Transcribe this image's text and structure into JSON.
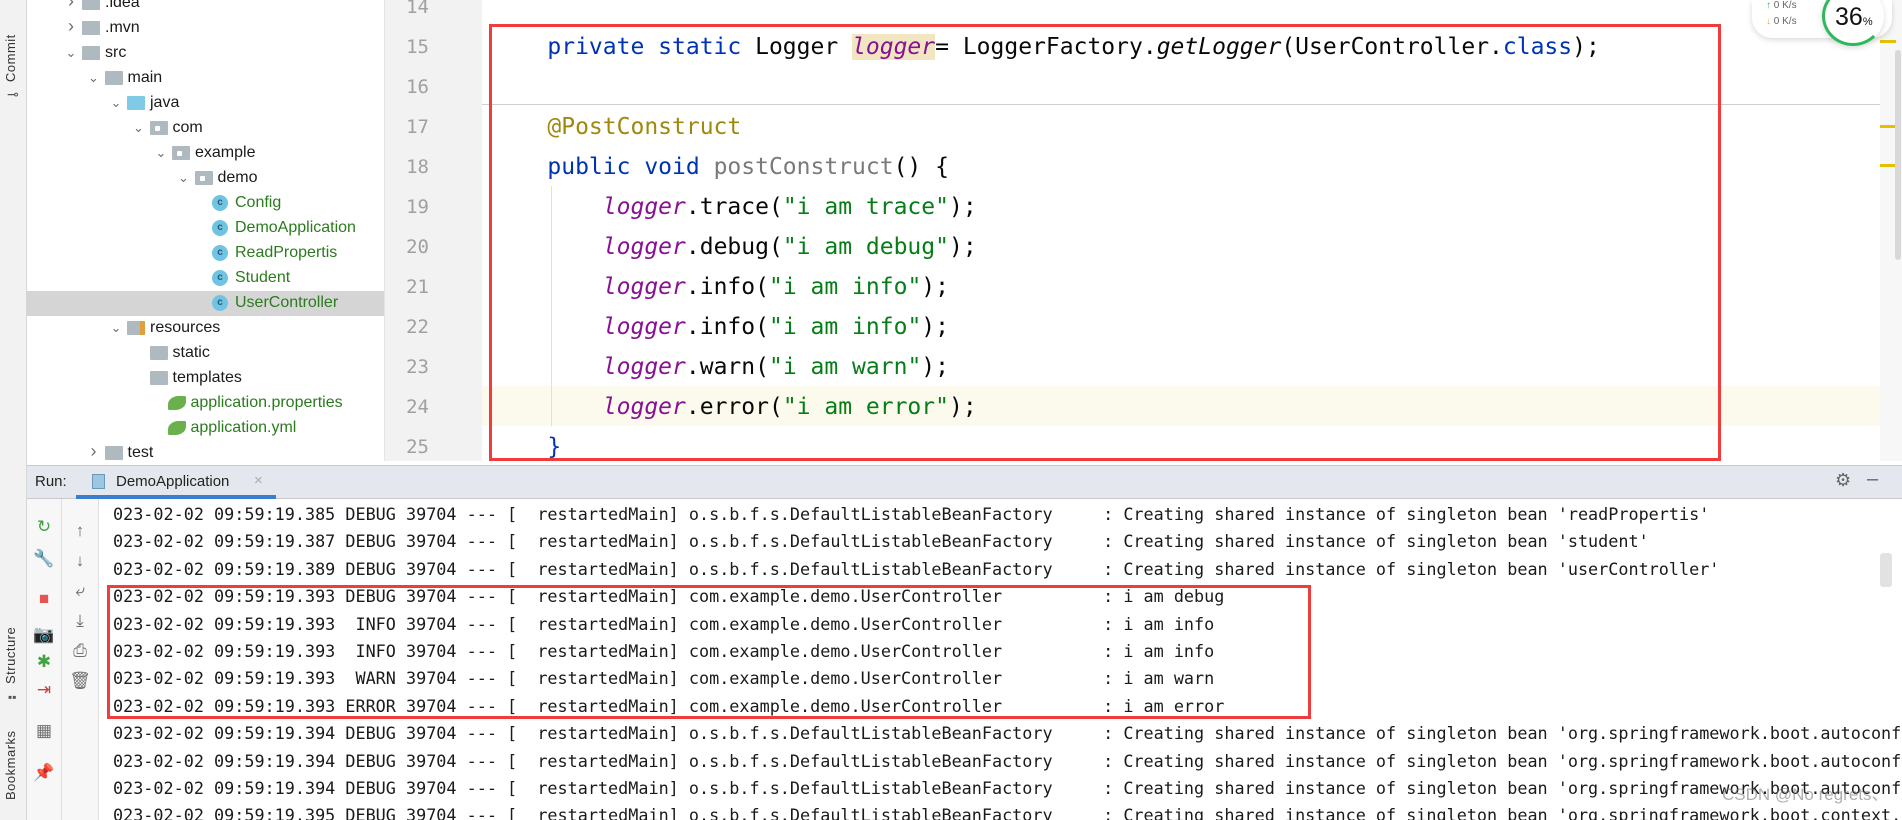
{
  "side_strip": {
    "commit": "Commit",
    "structure": "Structure",
    "bookmarks": "Bookmarks"
  },
  "project_tree": [
    {
      "label": ".idea",
      "level": 0,
      "icon": "folder",
      "chevron": "right"
    },
    {
      "label": ".mvn",
      "level": 0,
      "icon": "folder",
      "chevron": "right"
    },
    {
      "label": "src",
      "level": 0,
      "icon": "folder",
      "chevron": "down"
    },
    {
      "label": "main",
      "level": 1,
      "icon": "folder",
      "chevron": "down"
    },
    {
      "label": "java",
      "level": 2,
      "icon": "source-folder",
      "chevron": "down"
    },
    {
      "label": "com",
      "level": 3,
      "icon": "package",
      "chevron": "down"
    },
    {
      "label": "example",
      "level": 4,
      "icon": "package",
      "chevron": "down"
    },
    {
      "label": "demo",
      "level": 5,
      "icon": "package",
      "chevron": "down"
    },
    {
      "label": "Config",
      "level": 6,
      "icon": "class",
      "green": true
    },
    {
      "label": "DemoApplication",
      "level": 6,
      "icon": "class",
      "green": true
    },
    {
      "label": "ReadPropertis",
      "level": 6,
      "icon": "class",
      "green": true
    },
    {
      "label": "Student",
      "level": 6,
      "icon": "class",
      "green": true
    },
    {
      "label": "UserController",
      "level": 6,
      "icon": "class",
      "green": true,
      "selected": true
    },
    {
      "label": "resources",
      "level": 2,
      "icon": "resources-folder",
      "chevron": "down"
    },
    {
      "label": "static",
      "level": 3,
      "icon": "folder"
    },
    {
      "label": "templates",
      "level": 3,
      "icon": "folder"
    },
    {
      "label": "application.properties",
      "level": 3,
      "icon": "spring-leaf",
      "green": true
    },
    {
      "label": "application.yml",
      "level": 3,
      "icon": "spring-leaf",
      "green": true
    },
    {
      "label": "test",
      "level": 1,
      "icon": "folder",
      "chevron": "right"
    }
  ],
  "editor": {
    "line_numbers": [
      "14",
      "15",
      "16",
      "17",
      "18",
      "19",
      "20",
      "21",
      "22",
      "23",
      "24",
      "25"
    ],
    "lines": [
      [],
      [
        {
          "t": "    "
        },
        {
          "t": "private static ",
          "c": "kw"
        },
        {
          "t": "Logger "
        },
        {
          "t": "logger",
          "c": "fld hl"
        },
        {
          "t": "= LoggerFactory."
        },
        {
          "t": "getLogger",
          "c": "it"
        },
        {
          "t": "(UserController."
        },
        {
          "t": "class",
          "c": "kw"
        },
        {
          "t": ");"
        }
      ],
      [],
      [
        {
          "t": "    "
        },
        {
          "t": "@PostConstruct",
          "c": "ann"
        }
      ],
      [
        {
          "t": "    "
        },
        {
          "t": "public void ",
          "c": "kw"
        },
        {
          "t": "postConstruct",
          "c": "gray"
        },
        {
          "t": "() {"
        }
      ],
      [
        {
          "t": "        "
        },
        {
          "t": "logger",
          "c": "fld"
        },
        {
          "t": ".trace("
        },
        {
          "t": "\"i am trace\"",
          "c": "str"
        },
        {
          "t": ");"
        }
      ],
      [
        {
          "t": "        "
        },
        {
          "t": "logger",
          "c": "fld"
        },
        {
          "t": ".debug("
        },
        {
          "t": "\"i am debug\"",
          "c": "str"
        },
        {
          "t": ");"
        }
      ],
      [
        {
          "t": "        "
        },
        {
          "t": "logger",
          "c": "fld"
        },
        {
          "t": ".info("
        },
        {
          "t": "\"i am info\"",
          "c": "str"
        },
        {
          "t": ");"
        }
      ],
      [
        {
          "t": "        "
        },
        {
          "t": "logger",
          "c": "fld"
        },
        {
          "t": ".info("
        },
        {
          "t": "\"i am info\"",
          "c": "str"
        },
        {
          "t": ");"
        }
      ],
      [
        {
          "t": "        "
        },
        {
          "t": "logger",
          "c": "fld"
        },
        {
          "t": ".warn("
        },
        {
          "t": "\"i am warn\"",
          "c": "str"
        },
        {
          "t": ");"
        }
      ],
      [
        {
          "t": "        "
        },
        {
          "t": "logger",
          "c": "fld"
        },
        {
          "t": ".error("
        },
        {
          "t": "\"i am error\"",
          "c": "str"
        },
        {
          "t": ");"
        }
      ],
      [
        {
          "t": "    "
        },
        {
          "t": "}",
          "c": "kw"
        }
      ]
    ]
  },
  "network_widget": {
    "upload": "0",
    "download": "0",
    "unit": "K/s",
    "percent": "36",
    "percent_sign": "%"
  },
  "run_panel": {
    "label": "Run:",
    "tab": "DemoApplication",
    "close": "×"
  },
  "console_lines": [
    "023-02-02 09:59:19.385 DEBUG 39704 --- [  restartedMain] o.s.b.f.s.DefaultListableBeanFactory     : Creating shared instance of singleton bean 'readPropertis'",
    "023-02-02 09:59:19.387 DEBUG 39704 --- [  restartedMain] o.s.b.f.s.DefaultListableBeanFactory     : Creating shared instance of singleton bean 'student'",
    "023-02-02 09:59:19.389 DEBUG 39704 --- [  restartedMain] o.s.b.f.s.DefaultListableBeanFactory     : Creating shared instance of singleton bean 'userController'",
    "023-02-02 09:59:19.393 DEBUG 39704 --- [  restartedMain] com.example.demo.UserController          : i am debug",
    "023-02-02 09:59:19.393  INFO 39704 --- [  restartedMain] com.example.demo.UserController          : i am info",
    "023-02-02 09:59:19.393  INFO 39704 --- [  restartedMain] com.example.demo.UserController          : i am info",
    "023-02-02 09:59:19.393  WARN 39704 --- [  restartedMain] com.example.demo.UserController          : i am warn",
    "023-02-02 09:59:19.393 ERROR 39704 --- [  restartedMain] com.example.demo.UserController          : i am error",
    "023-02-02 09:59:19.394 DEBUG 39704 --- [  restartedMain] o.s.b.f.s.DefaultListableBeanFactory     : Creating shared instance of singleton bean 'org.springframework.boot.autoconfi",
    "023-02-02 09:59:19.394 DEBUG 39704 --- [  restartedMain] o.s.b.f.s.DefaultListableBeanFactory     : Creating shared instance of singleton bean 'org.springframework.boot.autoconfi",
    "023-02-02 09:59:19.394 DEBUG 39704 --- [  restartedMain] o.s.b.f.s.DefaultListableBeanFactory     : Creating shared instance of singleton bean 'org.springframework.boot.autoconfi",
    "023-02-02 09:59:19.395 DEBUG 39704 --- [  restartedMain] o.s.b.f.s.DefaultListableBeanFactory     : Creating shared instance of singleton bean 'org.springframework.boot.context.p"
  ],
  "watermark": "CSDN @No regrets、",
  "colors": {
    "highlight_box": "#f03c3c",
    "keyword": "#0033b3",
    "field": "#871094",
    "string": "#067d17",
    "annotation": "#9e880d",
    "tree_green": "#2b7b1e"
  }
}
